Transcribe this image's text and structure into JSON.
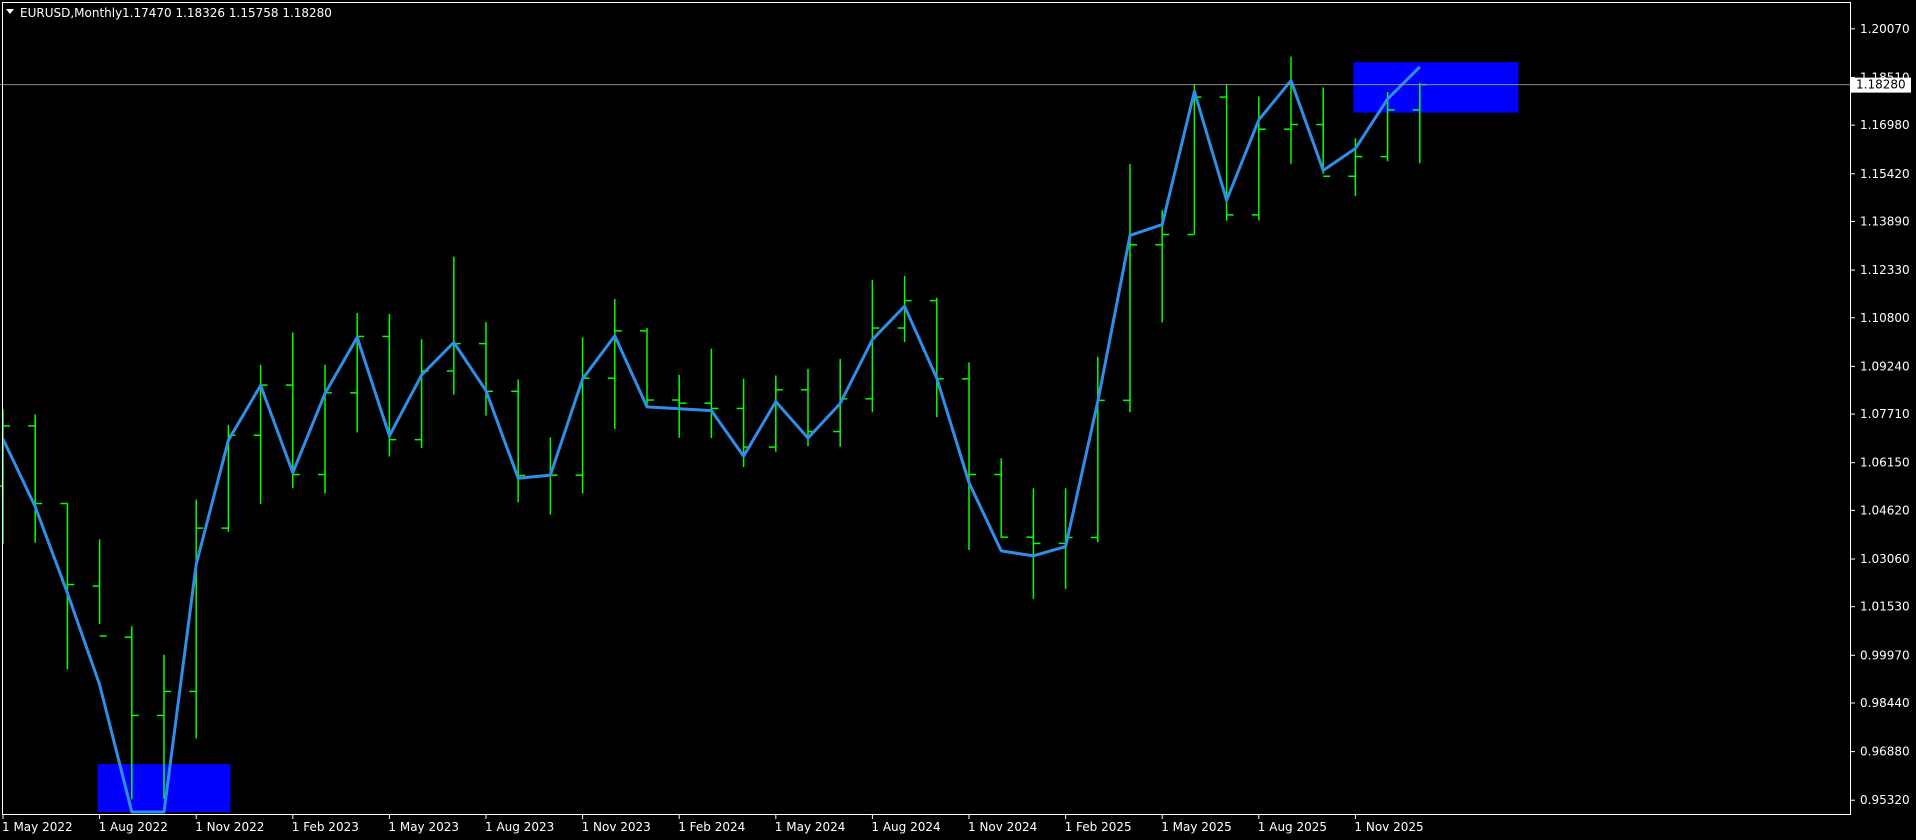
{
  "header": {
    "symbol_label": "EURUSD,Monthly",
    "ohlc_text": "1.17470 1.18326 1.15758 1.18280"
  },
  "current_price_label": "1.18280",
  "colors": {
    "background": "#000000",
    "bars": "#00ff00",
    "line": "#2f8fe8",
    "zone": "#0000ff",
    "axis": "#ffffff"
  },
  "chart_data": {
    "type": "ohlc",
    "period": "Monthly",
    "y_ticks": [
      "1.20070",
      "1.18510",
      "1.16980",
      "1.15420",
      "1.13890",
      "1.12330",
      "1.10800",
      "1.09240",
      "1.07710",
      "1.06150",
      "1.04620",
      "1.03060",
      "1.01530",
      "0.99970",
      "0.98440",
      "0.96880",
      "0.95320"
    ],
    "ylim": [
      0.9491,
      1.2061
    ],
    "x_ticks": [
      {
        "label": "1 May 2022",
        "index": 0
      },
      {
        "label": "1 Aug 2022",
        "index": 3
      },
      {
        "label": "1 Nov 2022",
        "index": 6
      },
      {
        "label": "1 Feb 2023",
        "index": 9
      },
      {
        "label": "1 May 2023",
        "index": 12
      },
      {
        "label": "1 Aug 2023",
        "index": 15
      },
      {
        "label": "1 Nov 2023",
        "index": 18
      },
      {
        "label": "1 Feb 2024",
        "index": 21
      },
      {
        "label": "1 May 2024",
        "index": 24
      },
      {
        "label": "1 Aug 2024",
        "index": 27
      },
      {
        "label": "1 Nov 2024",
        "index": 30
      },
      {
        "label": "1 Feb 2025",
        "index": 33
      },
      {
        "label": "1 May 2025",
        "index": 36
      },
      {
        "label": "1 Aug 2025",
        "index": 39
      },
      {
        "label": "1 Nov 2025",
        "index": 42
      }
    ],
    "bars": [
      {
        "o": 1.054,
        "h": 1.0787,
        "l": 1.0354,
        "c": 1.0733
      },
      {
        "o": 1.0733,
        "h": 1.077,
        "l": 1.0358,
        "c": 1.0484
      },
      {
        "o": 1.0484,
        "h": 1.0485,
        "l": 0.9952,
        "c": 1.0224
      },
      {
        "o": 1.0219,
        "h": 1.0369,
        "l": 1.0097,
        "c": 1.0059
      },
      {
        "o": 1.0055,
        "h": 1.009,
        "l": 0.9535,
        "c": 0.9804
      },
      {
        "o": 0.9804,
        "h": 0.9999,
        "l": 0.9536,
        "c": 0.9881
      },
      {
        "o": 0.9881,
        "h": 1.0497,
        "l": 0.973,
        "c": 1.0405
      },
      {
        "o": 1.0405,
        "h": 1.0736,
        "l": 1.0393,
        "c": 1.0703
      },
      {
        "o": 1.0703,
        "h": 1.0929,
        "l": 1.0483,
        "c": 1.0864
      },
      {
        "o": 1.0864,
        "h": 1.1033,
        "l": 1.0533,
        "c": 1.0577
      },
      {
        "o": 1.0577,
        "h": 1.0929,
        "l": 1.0516,
        "c": 1.0839
      },
      {
        "o": 1.0839,
        "h": 1.1095,
        "l": 1.0712,
        "c": 1.102
      },
      {
        "o": 1.102,
        "h": 1.1092,
        "l": 1.0635,
        "c": 1.0689
      },
      {
        "o": 1.0689,
        "h": 1.1011,
        "l": 1.0662,
        "c": 1.0909
      },
      {
        "o": 1.0909,
        "h": 1.1276,
        "l": 1.0833,
        "c": 1.0997
      },
      {
        "o": 1.0997,
        "h": 1.1066,
        "l": 1.0766,
        "c": 1.0844
      },
      {
        "o": 1.0844,
        "h": 1.0882,
        "l": 1.0488,
        "c": 1.0574
      },
      {
        "o": 1.0574,
        "h": 1.0696,
        "l": 1.0448,
        "c": 1.0575
      },
      {
        "o": 1.0575,
        "h": 1.1017,
        "l": 1.0516,
        "c": 1.0886
      },
      {
        "o": 1.0886,
        "h": 1.114,
        "l": 1.0723,
        "c": 1.1038
      },
      {
        "o": 1.1038,
        "h": 1.1047,
        "l": 1.0795,
        "c": 1.0816
      },
      {
        "o": 1.0816,
        "h": 1.0897,
        "l": 1.0695,
        "c": 1.0806
      },
      {
        "o": 1.0806,
        "h": 1.0981,
        "l": 1.0694,
        "c": 1.0789
      },
      {
        "o": 1.0789,
        "h": 1.0885,
        "l": 1.0601,
        "c": 1.0665
      },
      {
        "o": 1.0665,
        "h": 1.0895,
        "l": 1.065,
        "c": 1.0849
      },
      {
        "o": 1.0849,
        "h": 1.0916,
        "l": 1.0668,
        "c": 1.0715
      },
      {
        "o": 1.0715,
        "h": 1.0948,
        "l": 1.0666,
        "c": 1.082
      },
      {
        "o": 1.082,
        "h": 1.1202,
        "l": 1.0777,
        "c": 1.1047
      },
      {
        "o": 1.1047,
        "h": 1.1214,
        "l": 1.1002,
        "c": 1.1135
      },
      {
        "o": 1.1135,
        "h": 1.1144,
        "l": 1.0761,
        "c": 1.0884
      },
      {
        "o": 1.0884,
        "h": 1.0937,
        "l": 1.0335,
        "c": 1.0577
      },
      {
        "o": 1.0577,
        "h": 1.0629,
        "l": 1.0374,
        "c": 1.0376
      },
      {
        "o": 1.0376,
        "h": 1.0533,
        "l": 1.0178,
        "c": 1.0356
      },
      {
        "o": 1.0356,
        "h": 1.0533,
        "l": 1.021,
        "c": 1.0375
      },
      {
        "o": 1.0375,
        "h": 1.0955,
        "l": 1.036,
        "c": 1.0815
      },
      {
        "o": 1.0815,
        "h": 1.1573,
        "l": 1.0777,
        "c": 1.1314
      },
      {
        "o": 1.1314,
        "h": 1.1425,
        "l": 1.1065,
        "c": 1.1347
      },
      {
        "o": 1.1347,
        "h": 1.183,
        "l": 1.1347,
        "c": 1.1788
      },
      {
        "o": 1.1788,
        "h": 1.183,
        "l": 1.1391,
        "c": 1.141
      },
      {
        "o": 1.141,
        "h": 1.179,
        "l": 1.1392,
        "c": 1.1685
      },
      {
        "o": 1.1685,
        "h": 1.1918,
        "l": 1.1574,
        "c": 1.17
      },
      {
        "o": 1.17,
        "h": 1.1819,
        "l": 1.1542,
        "c": 1.1534
      },
      {
        "o": 1.1534,
        "h": 1.1656,
        "l": 1.147,
        "c": 1.1597
      },
      {
        "o": 1.1597,
        "h": 1.1804,
        "l": 1.1582,
        "c": 1.1747
      },
      {
        "o": 1.1747,
        "h": 1.1833,
        "l": 1.1576,
        "c": 1.1828
      }
    ],
    "line_series": [
      1.0691,
      1.0474,
      1.0197,
      0.9903,
      0.9491,
      0.9491,
      1.0289,
      1.0687,
      1.0863,
      1.0583,
      1.0837,
      1.1017,
      1.0701,
      1.0896,
      1.1001,
      1.0846,
      1.0565,
      1.0575,
      1.0884,
      1.1022,
      1.0794,
      1.0788,
      1.0782,
      1.0636,
      1.0811,
      1.0694,
      1.0805,
      1.101,
      1.1117,
      1.0886,
      1.0551,
      1.0332,
      1.0316,
      1.0346,
      1.0811,
      1.1344,
      1.1379,
      1.1806,
      1.1457,
      1.1715,
      1.1841,
      1.1553,
      1.1623,
      1.1782,
      1.1885
    ],
    "zones": [
      {
        "x_from_index": 3,
        "x_to_index": 7,
        "y_low": 0.9491,
        "y_high": 0.9648
      },
      {
        "x_from_index": 42,
        "x_to_index": 47,
        "y_low": 1.1738,
        "y_high": 1.19
      }
    ]
  }
}
